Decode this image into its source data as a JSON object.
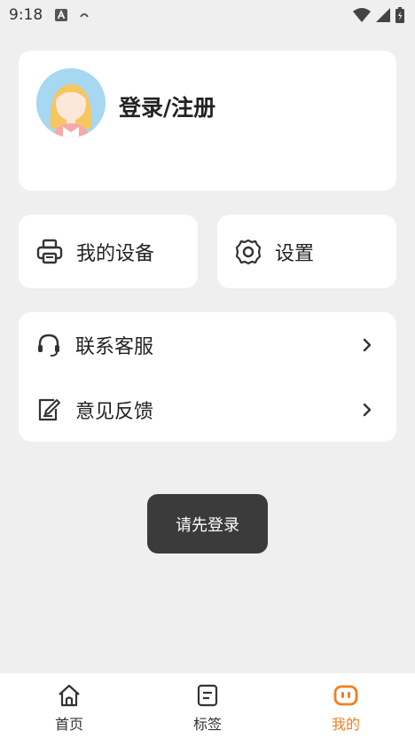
{
  "status_bar": {
    "time": "9:18"
  },
  "profile": {
    "login_label": "登录/注册"
  },
  "tiles": {
    "devices_label": "我的设备",
    "settings_label": "设置"
  },
  "list": {
    "customer_service": "联系客服",
    "feedback": "意见反馈"
  },
  "toast": {
    "text": "请先登录"
  },
  "tabbar": {
    "home": "首页",
    "tags": "标签",
    "mine": "我的",
    "active_tab": "mine",
    "accent_color": "#f07f1f"
  },
  "icons": {
    "devices": "printer-icon",
    "settings": "gear-icon",
    "service": "headset-icon",
    "feedback": "edit-note-icon",
    "home": "home-icon",
    "tags": "receipt-icon",
    "mine": "robot-face-icon"
  }
}
